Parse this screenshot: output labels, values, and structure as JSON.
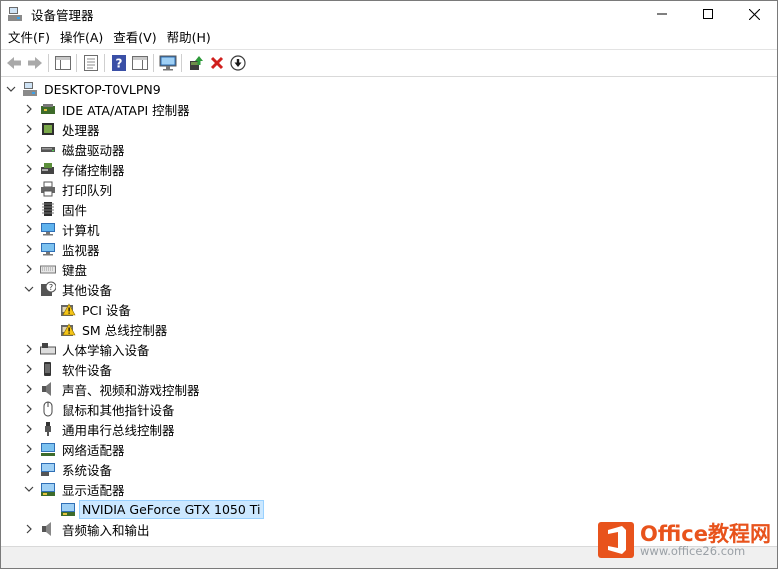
{
  "window": {
    "title": "设备管理器",
    "controls": [
      "minimize",
      "maximize",
      "close"
    ]
  },
  "menu": {
    "items": [
      {
        "label": "文件(F)"
      },
      {
        "label": "操作(A)"
      },
      {
        "label": "查看(V)"
      },
      {
        "label": "帮助(H)"
      }
    ]
  },
  "toolbar": {
    "buttons": [
      "back-icon",
      "forward-icon",
      "show-hide-tree-icon",
      "properties-icon",
      "help-icon",
      "show-actions-icon",
      "monitor-icon",
      "update-driver-icon",
      "uninstall-icon",
      "install-driver-icon"
    ]
  },
  "tree": {
    "root": "DESKTOP-T0VLPN9",
    "categories": [
      {
        "label": "IDE ATA/ATAPI 控制器",
        "icon": "ide-controller-icon"
      },
      {
        "label": "处理器",
        "icon": "processor-icon"
      },
      {
        "label": "磁盘驱动器",
        "icon": "disk-drive-icon"
      },
      {
        "label": "存储控制器",
        "icon": "storage-controller-icon"
      },
      {
        "label": "打印队列",
        "icon": "printer-icon"
      },
      {
        "label": "固件",
        "icon": "firmware-icon"
      },
      {
        "label": "计算机",
        "icon": "computer-icon"
      },
      {
        "label": "监视器",
        "icon": "monitor-icon"
      },
      {
        "label": "键盘",
        "icon": "keyboard-icon"
      },
      {
        "label": "其他设备",
        "icon": "unknown-device-icon",
        "expanded": true,
        "children": [
          {
            "label": "PCI 设备",
            "icon": "warning-device-icon"
          },
          {
            "label": "SM 总线控制器",
            "icon": "warning-device-icon"
          }
        ]
      },
      {
        "label": "人体学输入设备",
        "icon": "hid-icon"
      },
      {
        "label": "软件设备",
        "icon": "software-device-icon"
      },
      {
        "label": "声音、视频和游戏控制器",
        "icon": "speaker-icon"
      },
      {
        "label": "鼠标和其他指针设备",
        "icon": "mouse-icon"
      },
      {
        "label": "通用串行总线控制器",
        "icon": "usb-icon"
      },
      {
        "label": "网络适配器",
        "icon": "network-adapter-icon"
      },
      {
        "label": "系统设备",
        "icon": "system-device-icon"
      },
      {
        "label": "显示适配器",
        "icon": "display-adapter-icon",
        "expanded": true,
        "children": [
          {
            "label": "NVIDIA GeForce GTX 1050 Ti",
            "icon": "display-adapter-icon",
            "selected": true
          }
        ]
      },
      {
        "label": "音频输入和输出",
        "icon": "audio-io-icon"
      }
    ]
  },
  "watermark": {
    "title": "Office教程网",
    "url": "www.office26.com"
  }
}
